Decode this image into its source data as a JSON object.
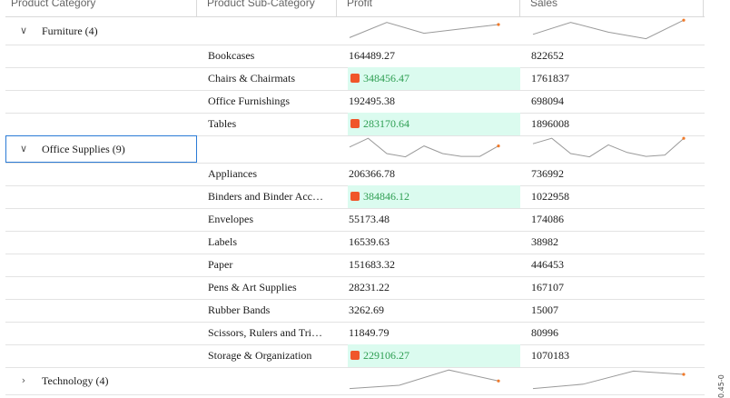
{
  "headers": [
    "Product Category",
    "Product Sub-Category",
    "Profit",
    "Sales"
  ],
  "groups": [
    {
      "title": "Furniture (4)",
      "expanded": true,
      "focused": false,
      "profit_spark": [
        0.15,
        0.85,
        0.35,
        0.55,
        0.75
      ],
      "sales_spark": [
        0.3,
        0.85,
        0.4,
        0.1,
        0.95
      ],
      "rows": [
        {
          "sub": "Bookcases",
          "profit": "164489.27",
          "sales": "822652",
          "highlight": false
        },
        {
          "sub": "Chairs & Chairmats",
          "profit": "348456.47",
          "sales": "1761837",
          "highlight": true
        },
        {
          "sub": "Office Furnishings",
          "profit": "192495.38",
          "sales": "698094",
          "highlight": false
        },
        {
          "sub": "Tables",
          "profit": "283170.64",
          "sales": "1896008",
          "highlight": true
        }
      ]
    },
    {
      "title": "Office Supplies (9)",
      "expanded": true,
      "focused": true,
      "profit_spark": [
        0.55,
        0.95,
        0.25,
        0.1,
        0.6,
        0.25,
        0.12,
        0.12,
        0.6
      ],
      "sales_spark": [
        0.7,
        0.95,
        0.25,
        0.1,
        0.65,
        0.3,
        0.12,
        0.18,
        0.95
      ],
      "rows": [
        {
          "sub": "Appliances",
          "profit": "206366.78",
          "sales": "736992",
          "highlight": false
        },
        {
          "sub": "Binders and Binder Acc…",
          "profit": "384846.12",
          "sales": "1022958",
          "highlight": true
        },
        {
          "sub": "Envelopes",
          "profit": "55173.48",
          "sales": "174086",
          "highlight": false
        },
        {
          "sub": "Labels",
          "profit": "16539.63",
          "sales": "38982",
          "highlight": false
        },
        {
          "sub": "Paper",
          "profit": "151683.32",
          "sales": "446453",
          "highlight": false
        },
        {
          "sub": "Pens & Art Supplies",
          "profit": "28231.22",
          "sales": "167107",
          "highlight": false
        },
        {
          "sub": "Rubber Bands",
          "profit": "3262.69",
          "sales": "15007",
          "highlight": false
        },
        {
          "sub": "Scissors, Rulers and Tri…",
          "profit": "11849.79",
          "sales": "80996",
          "highlight": false
        },
        {
          "sub": "Storage & Organization",
          "profit": "229106.27",
          "sales": "1070183",
          "highlight": true
        }
      ]
    },
    {
      "title": "Technology (4)",
      "expanded": false,
      "focused": false,
      "profit_spark": [
        0.1,
        0.25,
        0.95,
        0.45
      ],
      "sales_spark": [
        0.1,
        0.3,
        0.9,
        0.75
      ],
      "rows": []
    }
  ],
  "side_text": "0.45-0"
}
